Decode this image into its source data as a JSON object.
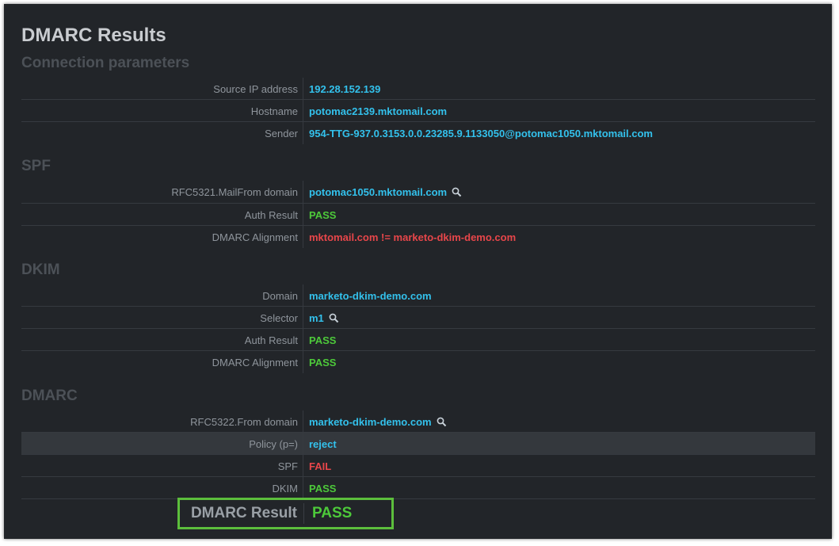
{
  "title": "DMARC Results",
  "sections": {
    "connection": {
      "heading": "Connection parameters",
      "rows": [
        {
          "label": "Source IP address",
          "value": "192.28.152.139"
        },
        {
          "label": "Hostname",
          "value": "potomac2139.mktomail.com"
        },
        {
          "label": "Sender",
          "value": "954-TTG-937.0.3153.0.0.23285.9.1133050@potomac1050.mktomail.com"
        }
      ]
    },
    "spf": {
      "heading": "SPF",
      "rows": [
        {
          "label": "RFC5321.MailFrom domain",
          "value": "potomac1050.mktomail.com"
        },
        {
          "label": "Auth Result",
          "value": "PASS"
        },
        {
          "label": "DMARC Alignment",
          "value": "mktomail.com != marketo-dkim-demo.com"
        }
      ]
    },
    "dkim": {
      "heading": "DKIM",
      "rows": [
        {
          "label": "Domain",
          "value": "marketo-dkim-demo.com"
        },
        {
          "label": "Selector",
          "value": "m1"
        },
        {
          "label": "Auth Result",
          "value": "PASS"
        },
        {
          "label": "DMARC Alignment",
          "value": "PASS"
        }
      ]
    },
    "dmarc": {
      "heading": "DMARC",
      "rows": [
        {
          "label": "RFC5322.From domain",
          "value": "marketo-dkim-demo.com"
        },
        {
          "label": "Policy (p=)",
          "value": "reject"
        },
        {
          "label": "SPF",
          "value": "FAIL"
        },
        {
          "label": "DKIM",
          "value": "PASS"
        }
      ]
    }
  },
  "result": {
    "label": "DMARC Result",
    "value": "PASS"
  },
  "colors": {
    "background": "#222529",
    "value_blue": "#33c1ec",
    "pass_green": "#4dc93a",
    "fail_red": "#e8464a",
    "highlight_border": "#5cbe3c"
  },
  "icons": {
    "lookup": "magnifier-icon"
  }
}
